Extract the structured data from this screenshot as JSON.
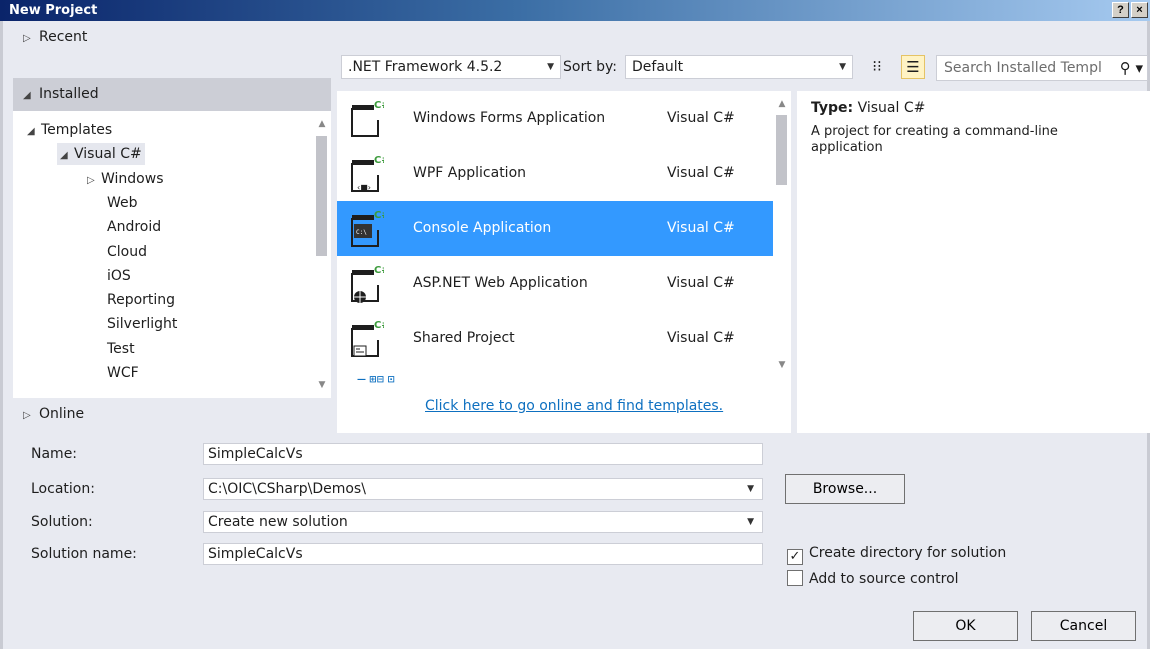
{
  "window": {
    "title": "New Project",
    "help_label": "?",
    "close_label": "×"
  },
  "left": {
    "recent": "Recent",
    "installed": "Installed",
    "online": "Online",
    "tree": [
      {
        "label": "Templates",
        "level": 0,
        "arrow": "◢"
      },
      {
        "label": "Visual C#",
        "level": 1,
        "arrow": "◢",
        "selected": true
      },
      {
        "label": "Windows",
        "level": 2,
        "arrow": "▷"
      },
      {
        "label": "Web",
        "level": 3
      },
      {
        "label": "Android",
        "level": 3
      },
      {
        "label": "Cloud",
        "level": 3
      },
      {
        "label": "iOS",
        "level": 3
      },
      {
        "label": "Reporting",
        "level": 3
      },
      {
        "label": "Silverlight",
        "level": 3
      },
      {
        "label": "Test",
        "level": 3
      },
      {
        "label": "WCF",
        "level": 3
      }
    ]
  },
  "toolbar": {
    "framework": ".NET Framework 4.5.2",
    "sort_label": "Sort by:",
    "sort_value": "Default",
    "search_placeholder": "Search Installed Templ"
  },
  "templates": [
    {
      "name": "Windows Forms Application",
      "lang": "Visual C#",
      "icon": "winforms-icon"
    },
    {
      "name": "WPF Application",
      "lang": "Visual C#",
      "icon": "wpf-icon"
    },
    {
      "name": "Console Application",
      "lang": "Visual C#",
      "icon": "console-icon",
      "selected": true
    },
    {
      "name": "ASP.NET Web Application",
      "lang": "Visual C#",
      "icon": "aspnet-icon"
    },
    {
      "name": "Shared Project",
      "lang": "Visual C#",
      "icon": "shared-project-icon"
    }
  ],
  "online_link": "Click here to go online and find templates.",
  "description": {
    "type_label": "Type:",
    "type_value": "Visual C#",
    "text": "A project for creating a command-line application"
  },
  "form": {
    "name_label": "Name:",
    "name_value": "SimpleCalcVs",
    "location_label": "Location:",
    "location_value": "C:\\OIC\\CSharp\\Demos\\",
    "solution_label": "Solution:",
    "solution_value": "Create new solution",
    "solution_name_label": "Solution name:",
    "solution_name_value": "SimpleCalcVs",
    "browse_label": "Browse...",
    "create_dir_label": "Create directory for solution",
    "create_dir_checked": true,
    "source_control_label": "Add to source control",
    "source_control_checked": false,
    "ok_label": "OK",
    "cancel_label": "Cancel"
  },
  "colors": {
    "selection": "#3399ff",
    "link": "#0e70c0",
    "background": "#e8eaf1"
  }
}
